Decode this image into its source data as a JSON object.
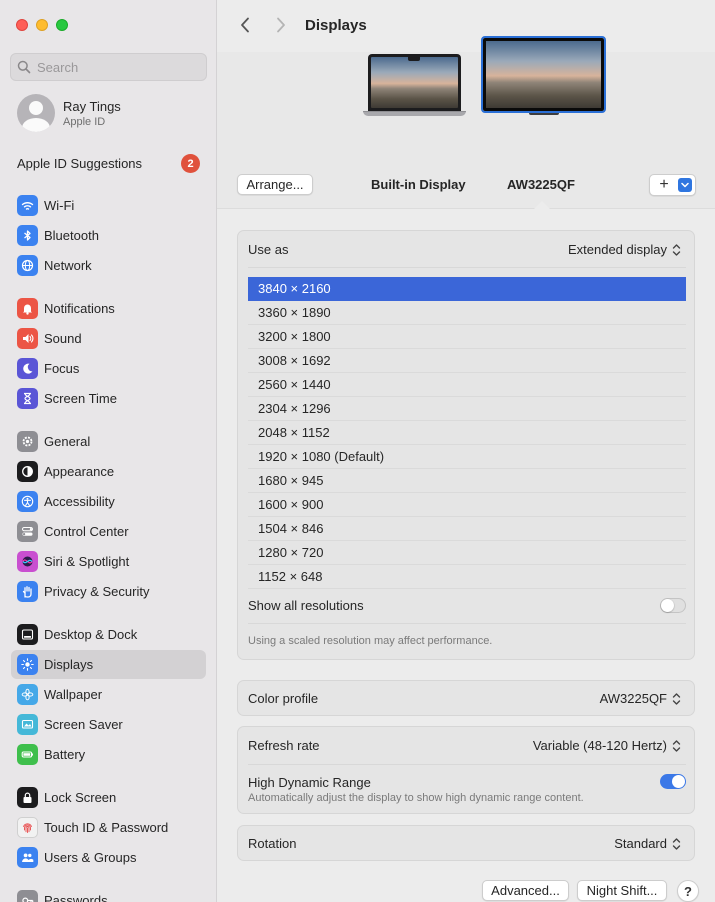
{
  "sidebar": {
    "search_placeholder": "Search",
    "account": {
      "name": "Ray Tings",
      "subtitle": "Apple ID"
    },
    "suggestions": {
      "label": "Apple ID Suggestions",
      "badge": "2"
    },
    "items": [
      {
        "label": "Wi-Fi",
        "icon": "wifi-icon",
        "color": "#3b82f0"
      },
      {
        "label": "Bluetooth",
        "icon": "bluetooth-icon",
        "color": "#3b82f0"
      },
      {
        "label": "Network",
        "icon": "globe-icon",
        "color": "#3b82f0"
      },
      {
        "label": "Notifications",
        "icon": "bell-icon",
        "color": "#ec5545"
      },
      {
        "label": "Sound",
        "icon": "speaker-icon",
        "color": "#ec5545"
      },
      {
        "label": "Focus",
        "icon": "moon-icon",
        "color": "#5a55d6"
      },
      {
        "label": "Screen Time",
        "icon": "hourglass-icon",
        "color": "#5a55d6"
      },
      {
        "label": "General",
        "icon": "gear-icon",
        "color": "#8e8e93"
      },
      {
        "label": "Appearance",
        "icon": "appearance-icon",
        "color": "#1c1c1e"
      },
      {
        "label": "Accessibility",
        "icon": "accessibility-icon",
        "color": "#3b82f0"
      },
      {
        "label": "Control Center",
        "icon": "control-center-icon",
        "color": "#8e8e93"
      },
      {
        "label": "Siri & Spotlight",
        "icon": "siri-icon",
        "color": "#c94fd0"
      },
      {
        "label": "Privacy & Security",
        "icon": "hand-icon",
        "color": "#3b82f0"
      },
      {
        "label": "Desktop & Dock",
        "icon": "dock-icon",
        "color": "#1c1c1e"
      },
      {
        "label": "Displays",
        "icon": "sun-icon",
        "color": "#3b82f0"
      },
      {
        "label": "Wallpaper",
        "icon": "flower-icon",
        "color": "#45a8e8"
      },
      {
        "label": "Screen Saver",
        "icon": "screen-saver-icon",
        "color": "#45b8d8"
      },
      {
        "label": "Battery",
        "icon": "battery-icon",
        "color": "#3fbf4c"
      },
      {
        "label": "Lock Screen",
        "icon": "lock-icon",
        "color": "#1c1c1e"
      },
      {
        "label": "Touch ID & Password",
        "icon": "fingerprint-icon",
        "color": "#f2f2f2"
      },
      {
        "label": "Users & Groups",
        "icon": "users-icon",
        "color": "#3b82f0"
      },
      {
        "label": "Passwords",
        "icon": "key-icon",
        "color": "#8e8e93"
      }
    ],
    "selected": "Displays"
  },
  "toolbar": {
    "title": "Displays"
  },
  "arrangement": {
    "arrange_button": "Arrange...",
    "builtin_label": "Built-in Display",
    "external_label": "AW3225QF",
    "add_button": "+"
  },
  "use_as": {
    "label": "Use as",
    "value": "Extended display",
    "resolutions": [
      "3840 × 2160",
      "3360 × 1890",
      "3200 × 1800",
      "3008 × 1692",
      "2560 × 1440",
      "2304 × 1296",
      "2048 × 1152",
      "1920 × 1080 (Default)",
      "1680 × 945",
      "1600 × 900",
      "1504 × 846",
      "1280 × 720",
      "1152 × 648"
    ],
    "selected_resolution": "3840 × 2160",
    "show_all_label": "Show all resolutions",
    "show_all_enabled": false,
    "note": "Using a scaled resolution may affect performance."
  },
  "color_profile": {
    "label": "Color profile",
    "value": "AW3225QF"
  },
  "refresh": {
    "label": "Refresh rate",
    "value": "Variable (48-120 Hertz)",
    "hdr_label": "High Dynamic Range",
    "hdr_desc": "Automatically adjust the display to show high dynamic range content.",
    "hdr_enabled": true
  },
  "rotation": {
    "label": "Rotation",
    "value": "Standard"
  },
  "footer": {
    "advanced": "Advanced...",
    "night_shift": "Night Shift...",
    "help": "?"
  },
  "colors": {
    "accent": "#3b66d8",
    "toggle_on": "#3b78e7",
    "badge": "#e0513c"
  }
}
